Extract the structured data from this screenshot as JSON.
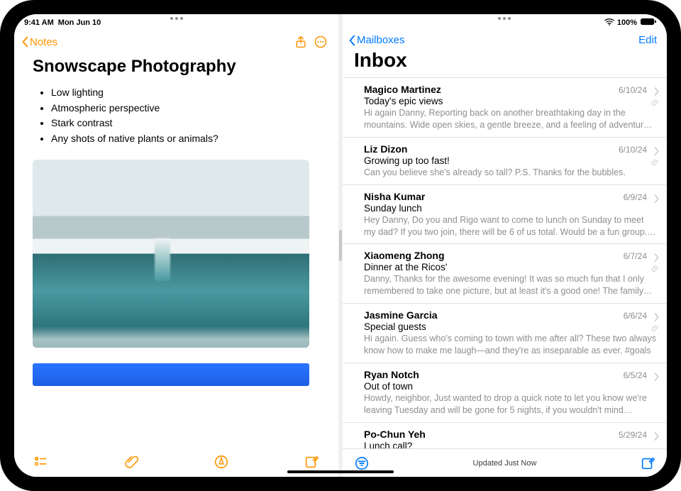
{
  "status": {
    "time": "9:41 AM",
    "date": "Mon Jun 10",
    "battery": "100%"
  },
  "notes": {
    "back_label": "Notes",
    "title": "Snowscape Photography",
    "bullets": [
      "Low lighting",
      "Atmospheric perspective",
      "Stark contrast",
      "Any shots of native plants or animals?"
    ]
  },
  "mail": {
    "back_label": "Mailboxes",
    "edit_label": "Edit",
    "inbox_title": "Inbox",
    "status_text": "Updated Just Now",
    "messages": [
      {
        "sender": "Magico Martinez",
        "date": "6/10/24",
        "subject": "Today's epic views",
        "preview": "Hi again Danny, Reporting back on another breathtaking day in the mountains. Wide open skies, a gentle breeze, and a feeling of adventure in the air. I felt l...",
        "attachment": true
      },
      {
        "sender": "Liz Dizon",
        "date": "6/10/24",
        "subject": "Growing up too fast!",
        "preview": "Can you believe she's already so tall? P.S. Thanks for the bubbles.",
        "attachment": true
      },
      {
        "sender": "Nisha Kumar",
        "date": "6/9/24",
        "subject": "Sunday lunch",
        "preview": "Hey Danny, Do you and Rigo want to come to lunch on Sunday to meet my dad? If you two join, there will be 6 of us total. Would be a fun group. Even if...",
        "attachment": false
      },
      {
        "sender": "Xiaomeng Zhong",
        "date": "6/7/24",
        "subject": "Dinner at the Ricos'",
        "preview": "Danny, Thanks for the awesome evening! It was so much fun that I only remembered to take one picture, but at least it's a good one! The family and...",
        "attachment": true
      },
      {
        "sender": "Jasmine Garcia",
        "date": "6/6/24",
        "subject": "Special guests",
        "preview": "Hi again. Guess who's coming to town with me after all? These two always know how to make me laugh—and they're as inseparable as ever. #goals",
        "attachment": true
      },
      {
        "sender": "Ryan Notch",
        "date": "6/5/24",
        "subject": "Out of town",
        "preview": "Howdy, neighbor, Just wanted to drop a quick note to let you know we're leaving Tuesday and will be gone for 5 nights, if you wouldn't mind keeping...",
        "attachment": false
      },
      {
        "sender": "Po-Chun Yeh",
        "date": "5/29/24",
        "subject": "Lunch call?",
        "preview": "",
        "attachment": false
      }
    ]
  }
}
